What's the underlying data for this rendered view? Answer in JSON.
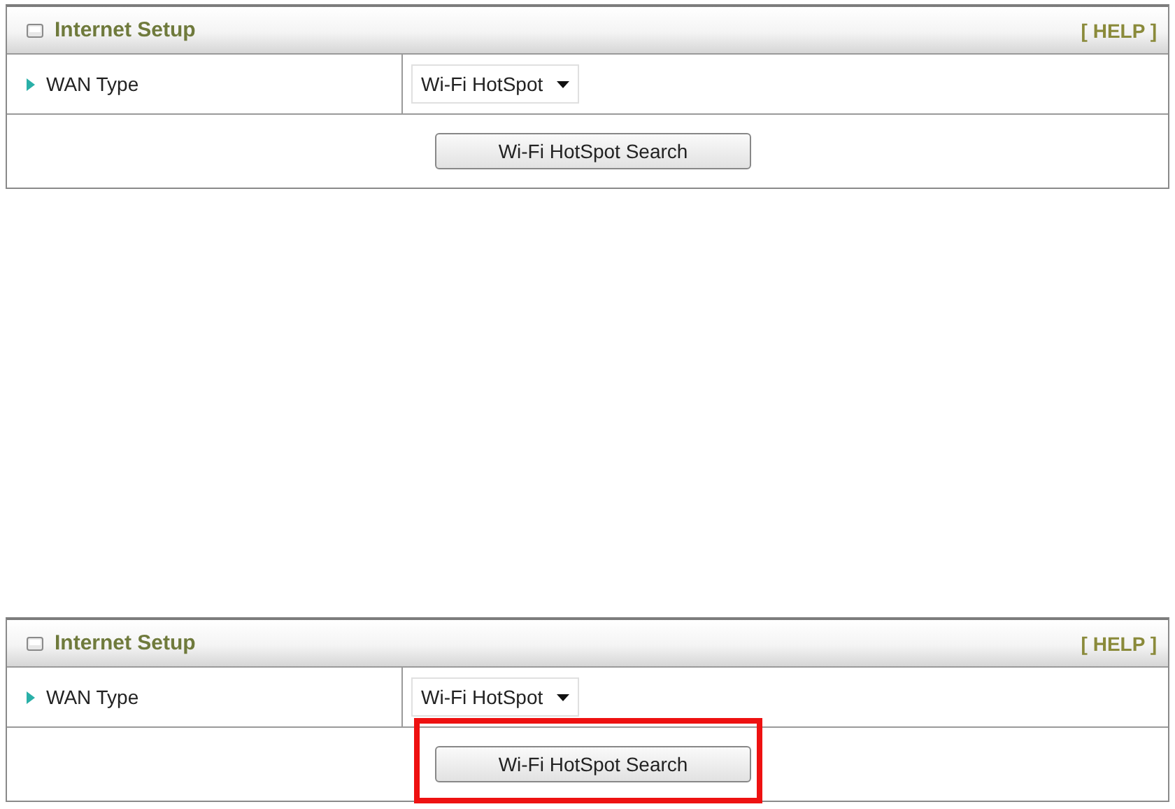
{
  "panels": [
    {
      "title": "Internet Setup",
      "help": "[ HELP ]",
      "field_label": "WAN Type",
      "wan_type": "Wi-Fi HotSpot",
      "button": "Wi-Fi HotSpot Search",
      "highlighted": false
    },
    {
      "title": "Internet Setup",
      "help": "[ HELP ]",
      "field_label": "WAN Type",
      "wan_type": "Wi-Fi HotSpot",
      "button": "Wi-Fi HotSpot Search",
      "highlighted": true
    }
  ]
}
